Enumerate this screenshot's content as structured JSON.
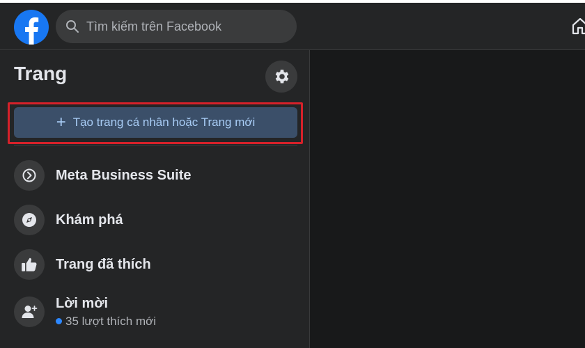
{
  "header": {
    "search": {
      "placeholder": "Tìm kiếm trên Facebook"
    },
    "brand_color": "#1877f2"
  },
  "sidebar": {
    "title": "Trang",
    "create_button": {
      "icon": "plus-icon",
      "label": "Tạo trang cá nhân hoặc Trang mới"
    },
    "items": [
      {
        "label": "Meta Business Suite",
        "icon": "business-suite-icon"
      },
      {
        "label": "Khám phá",
        "icon": "explore-compass-icon"
      },
      {
        "label": "Trang đã thích",
        "icon": "thumbs-up-icon"
      },
      {
        "label": "Lời mời",
        "icon": "add-person-icon",
        "sub": "35 lượt thích mới",
        "dot_color": "#2d88ff"
      }
    ]
  },
  "colors": {
    "highlight": "#d6212a",
    "create_button_bg": "#3b4f69",
    "create_button_text": "#a9cdf6"
  }
}
